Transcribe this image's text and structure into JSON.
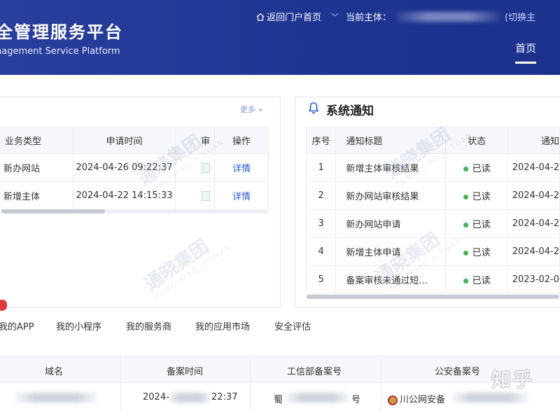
{
  "header": {
    "title_cn": "全管理服务平台",
    "title_en": "nagement Service Platform",
    "portal_link": "返回门户首页",
    "current_subject_label": "当前主体：",
    "switch_link": "(切换主",
    "nav_home": "首页"
  },
  "left_panel": {
    "more": "更多 »",
    "columns": [
      "业务类型",
      "申请时间",
      "审",
      "操作"
    ],
    "rows": [
      {
        "type": "新办网站",
        "time": "2024-04-26 09:22:37",
        "action": "详情"
      },
      {
        "type": "新增主体",
        "time": "2024-04-22 14:15:33",
        "action": "详情"
      }
    ]
  },
  "notice_panel": {
    "title": "系统通知",
    "columns": [
      "序号",
      "通知标题",
      "状态",
      "通知"
    ],
    "rows": [
      {
        "no": "1",
        "title": "新增主体审核结果",
        "status": "已读",
        "time": "2024-04-2"
      },
      {
        "no": "2",
        "title": "新办网站审核结果",
        "status": "已读",
        "time": "2024-04-2"
      },
      {
        "no": "3",
        "title": "新办网站申请",
        "status": "已读",
        "time": "2024-04-2"
      },
      {
        "no": "4",
        "title": "新增主体申请",
        "status": "已读",
        "time": "2024-04-2"
      },
      {
        "no": "5",
        "title": "备案审核未通过短...",
        "status": "已读",
        "time": "2023-02-0"
      }
    ]
  },
  "tabs": [
    "我的APP",
    "我的小程序",
    "我的服务商",
    "我的应用市场",
    "安全评估"
  ],
  "bottom_table": {
    "columns": [
      "域名",
      "备案时间",
      "工信部备案号",
      "公安备案号"
    ],
    "row": {
      "time_left": "2024-",
      "time_right": "22:37",
      "miit_prefix": "蜀",
      "miit_suffix": "号",
      "police": "川公网安备"
    }
  },
  "watermark": {
    "cn": "通晓集团",
    "en": "TONG XIAO JI TUAN"
  },
  "corner_mark": "知乎",
  "colors": {
    "header_bg": "#1f3592",
    "link": "#2b58d6",
    "read_dot": "#46b35a",
    "badge": "#e0393e"
  }
}
